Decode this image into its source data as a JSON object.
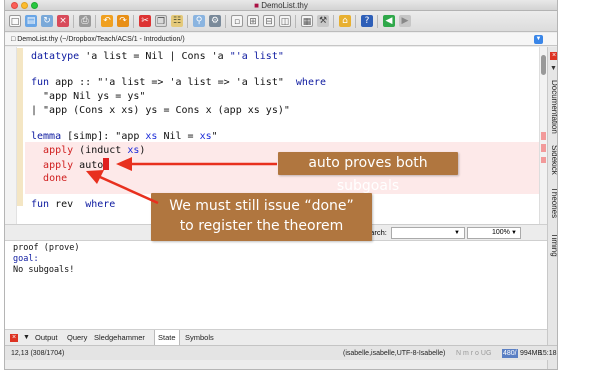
{
  "window": {
    "title": "DemoList.thy"
  },
  "path": {
    "label": "DemoList.thy (~/Dropbox/Teach/ACS/1 - Introduction/)"
  },
  "code": {
    "l1": {
      "kw": "datatype",
      "rest": " 'a list = Nil | Cons 'a ",
      "tail": "\"'a list\""
    },
    "l2": {
      "kw": "fun",
      "rest": " app :: \"'a list => 'a list => 'a list\"  ",
      "where": "where"
    },
    "l3": "  \"app Nil ys = ys\"",
    "l4": "| \"app (Cons x xs) ys = Cons x (app xs ys)\"",
    "l5": {
      "kw": "lemma",
      "rest": " [simp]: \"app ",
      "xs": "xs",
      "rest2": " Nil = ",
      "xs2": "xs",
      "end": "\""
    },
    "l6": {
      "kw": "apply",
      "rest": " (induct ",
      "xs": "xs",
      "end": ")"
    },
    "l7": {
      "kw": "apply",
      "rest": " auto"
    },
    "l8": {
      "kw": "done"
    },
    "l9": {
      "kw": "fun",
      "rest": " rev  ",
      "where": "where"
    }
  },
  "side_tabs": [
    "Documentation",
    "Sidekick",
    "Theories",
    "Timing"
  ],
  "output_header": {
    "search_label": "Search:",
    "zoom": "100%"
  },
  "output": {
    "l1": "proof (prove)",
    "l2": "goal:",
    "l3": "No subgoals!"
  },
  "bottom_tabs": [
    "Output",
    "Query",
    "Sledgehammer",
    "State",
    "Symbols"
  ],
  "status": {
    "pos": "12,13 (308/1704)",
    "mode": "(isabelle,isabelle,UTF-8-Isabelle)",
    "flags": "N m r o UG",
    "mem1": "480/",
    "mem2": "994MB",
    "time": "15:18"
  },
  "callouts": {
    "c1": "auto proves both subgoals",
    "c2a": "We must still issue “done”",
    "c2b": "to register the theorem"
  },
  "colors": {
    "callout": "#b0763f",
    "keyword": "#0d1aa0",
    "error": "#d02020",
    "arrow": "#e8301e"
  }
}
